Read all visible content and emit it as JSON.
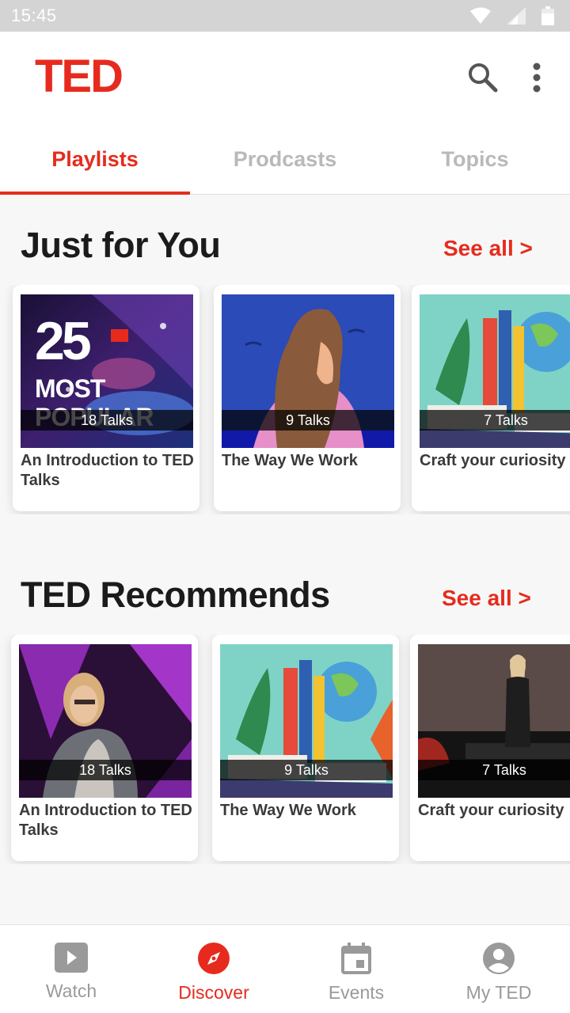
{
  "status_bar": {
    "time": "15:45"
  },
  "app": {
    "logo": "TED"
  },
  "tabs": [
    {
      "label": "Playlists",
      "active": true
    },
    {
      "label": "Prodcasts",
      "active": false
    },
    {
      "label": "Topics",
      "active": false
    }
  ],
  "sections": [
    {
      "title": "Just for You",
      "see_all": "See all >",
      "cards": [
        {
          "title": "An Introduction to TED Talks",
          "count": "18 Talks",
          "overlay_text": "25 MOST POPULAR"
        },
        {
          "title": "The Way We Work",
          "count": "9 Talks"
        },
        {
          "title": "Craft your curiosity",
          "count": "7 Talks"
        }
      ]
    },
    {
      "title": "TED Recommends",
      "see_all": "See all >",
      "cards": [
        {
          "title": "An Introduction to TED Talks",
          "count": "18 Talks"
        },
        {
          "title": "The Way We Work",
          "count": "9 Talks"
        },
        {
          "title": "Craft your curiosity",
          "count": "7 Talks"
        }
      ]
    }
  ],
  "bottom_nav": [
    {
      "label": "Watch",
      "icon": "play-icon",
      "active": false
    },
    {
      "label": "Discover",
      "icon": "compass-icon",
      "active": true
    },
    {
      "label": "Events",
      "icon": "calendar-icon",
      "active": false
    },
    {
      "label": "My TED",
      "icon": "account-icon",
      "active": false
    }
  ],
  "colors": {
    "accent": "#e62b1e",
    "inactive": "#9a9a9a",
    "tab_inactive": "#b9b9b9"
  }
}
